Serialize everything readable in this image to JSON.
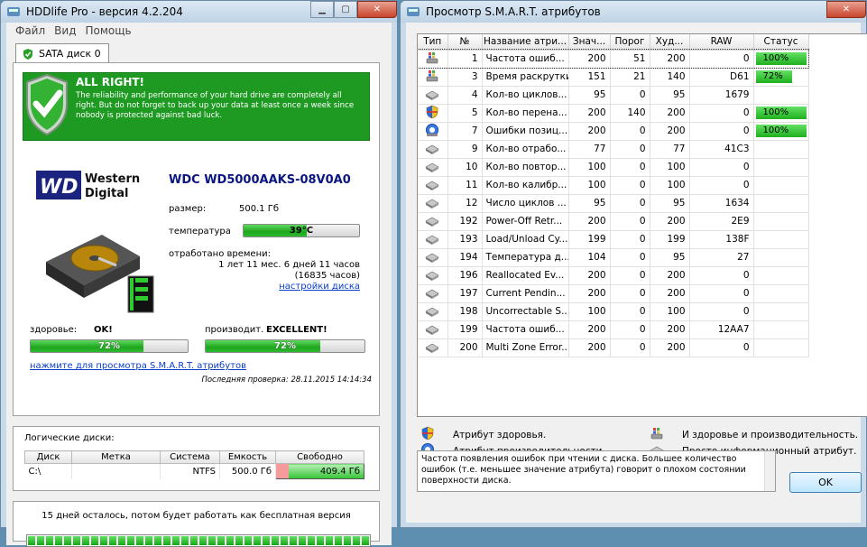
{
  "left_window": {
    "title": "HDDlife Pro - версия 4.2.204",
    "menu": [
      "Файл",
      "Вид",
      "Помощь"
    ],
    "tab": "SATA диск 0",
    "banner": {
      "title": "ALL RIGHT!",
      "text": "The reliability and performance of your hard drive are completely all right. But do not forget to back up your data at least once a week since nobody is protected against bad luck."
    },
    "brand_line1": "Western",
    "brand_line2": "Digital",
    "brand_mark": "WD",
    "model": "WDC WD5000AAKS-08V0A0",
    "size_label": "размер:",
    "size_value": "500.1 Гб",
    "temp_label": "температура",
    "temp_value": "39°C",
    "temp_fraction": 0.55,
    "worked_label": "отработано времени:",
    "worked_value": "1 лет 11 мес. 6 дней 11 часов",
    "worked_hours": "(16835 часов)",
    "disk_settings_link": "настройки диска",
    "health_label": "здоровье:",
    "health_status": "OK!",
    "health_value": "72%",
    "health_fraction": 0.72,
    "perf_label": "производит.",
    "perf_status": "EXCELLENT!",
    "perf_value": "72%",
    "perf_fraction": 0.72,
    "smart_link": "нажмите для просмотра S.M.A.R.T. атрибутов",
    "last_check": "Последняя проверка:  28.11.2015 14:14:34",
    "logical_title": "Логические диски:",
    "logical_headers": [
      "Диск",
      "Метка",
      "Система",
      "Емкость",
      "Свободно"
    ],
    "logical_rows": [
      {
        "disk": "C:\\",
        "label": "",
        "fs": "NTFS",
        "capacity": "500.0 Гб",
        "free": "409.4 Гб"
      }
    ],
    "trial_text": "15 дней осталось, потом будет работать как бесплатная версия"
  },
  "right_window": {
    "title": "Просмотр S.M.A.R.T. атрибутов",
    "headers": [
      "Тип",
      "№",
      "Название атри...",
      "Знач...",
      "Порог",
      "Худ...",
      "RAW",
      "Статус"
    ],
    "rows": [
      {
        "type": "both",
        "id": "1",
        "name": "Частота ошиб...",
        "value": "200",
        "threshold": "51",
        "worst": "200",
        "raw": "0",
        "status": "100%",
        "status_fraction": 1.0
      },
      {
        "type": "both",
        "id": "3",
        "name": "Время раскрутки",
        "value": "151",
        "threshold": "21",
        "worst": "140",
        "raw": "D61",
        "status": "72%",
        "status_fraction": 0.72
      },
      {
        "type": "info",
        "id": "4",
        "name": "Кол-во циклов...",
        "value": "95",
        "threshold": "0",
        "worst": "95",
        "raw": "1679",
        "status": "",
        "status_fraction": 0
      },
      {
        "type": "health",
        "id": "5",
        "name": "Кол-во перена...",
        "value": "200",
        "threshold": "140",
        "worst": "200",
        "raw": "0",
        "status": "100%",
        "status_fraction": 1.0
      },
      {
        "type": "perf",
        "id": "7",
        "name": "Ошибки позиц...",
        "value": "200",
        "threshold": "0",
        "worst": "200",
        "raw": "0",
        "status": "100%",
        "status_fraction": 1.0
      },
      {
        "type": "info",
        "id": "9",
        "name": "Кол-во отрабо...",
        "value": "77",
        "threshold": "0",
        "worst": "77",
        "raw": "41C3",
        "status": "",
        "status_fraction": 0
      },
      {
        "type": "info",
        "id": "10",
        "name": "Кол-во повтор...",
        "value": "100",
        "threshold": "0",
        "worst": "100",
        "raw": "0",
        "status": "",
        "status_fraction": 0
      },
      {
        "type": "info",
        "id": "11",
        "name": "Кол-во калибр...",
        "value": "100",
        "threshold": "0",
        "worst": "100",
        "raw": "0",
        "status": "",
        "status_fraction": 0
      },
      {
        "type": "info",
        "id": "12",
        "name": "Число циклов ...",
        "value": "95",
        "threshold": "0",
        "worst": "95",
        "raw": "1634",
        "status": "",
        "status_fraction": 0
      },
      {
        "type": "info",
        "id": "192",
        "name": "Power-Off Retr...",
        "value": "200",
        "threshold": "0",
        "worst": "200",
        "raw": "2E9",
        "status": "",
        "status_fraction": 0
      },
      {
        "type": "info",
        "id": "193",
        "name": "Load/Unload Cy...",
        "value": "199",
        "threshold": "0",
        "worst": "199",
        "raw": "138F",
        "status": "",
        "status_fraction": 0
      },
      {
        "type": "info",
        "id": "194",
        "name": "Температура д...",
        "value": "104",
        "threshold": "0",
        "worst": "95",
        "raw": "27",
        "status": "",
        "status_fraction": 0
      },
      {
        "type": "info",
        "id": "196",
        "name": "Reallocated Ev...",
        "value": "200",
        "threshold": "0",
        "worst": "200",
        "raw": "0",
        "status": "",
        "status_fraction": 0
      },
      {
        "type": "info",
        "id": "197",
        "name": "Current Pendin...",
        "value": "200",
        "threshold": "0",
        "worst": "200",
        "raw": "0",
        "status": "",
        "status_fraction": 0
      },
      {
        "type": "info",
        "id": "198",
        "name": "Uncorrectable S...",
        "value": "100",
        "threshold": "0",
        "worst": "100",
        "raw": "0",
        "status": "",
        "status_fraction": 0
      },
      {
        "type": "info",
        "id": "199",
        "name": "Частота ошиб...",
        "value": "200",
        "threshold": "0",
        "worst": "200",
        "raw": "12AA7",
        "status": "",
        "status_fraction": 0
      },
      {
        "type": "info",
        "id": "200",
        "name": "Multi Zone Error...",
        "value": "200",
        "threshold": "0",
        "worst": "200",
        "raw": "0",
        "status": "",
        "status_fraction": 0
      }
    ],
    "legend": {
      "health": "Атрибут здоровья.",
      "both": "И здоровье и производительность.",
      "perf": "Атрибут производительности.",
      "info": "Просто информационный атрибут."
    },
    "description": "Частота появления ошибок при чтении с диска. Большее количество ошибок (т.е. меньшее значение атрибута) говорит о плохом состоянии поверхности диска.",
    "ok_label": "OK"
  },
  "colors": {
    "banner_green": "#1e9a22",
    "bar_green": "#20b020",
    "model_blue": "#0a1580",
    "link_blue": "#0a3cc8"
  }
}
